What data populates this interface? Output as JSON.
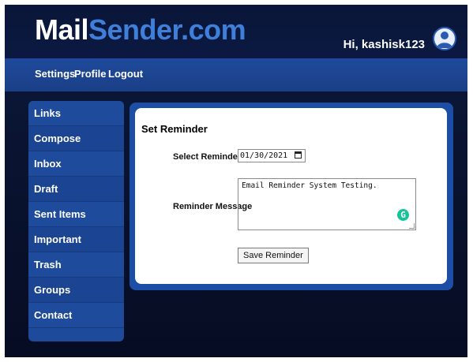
{
  "header": {
    "logo_part1": "Mail",
    "logo_part2": "Sender.com",
    "greeting": "Hi, kashisk123"
  },
  "nav": {
    "items": [
      "Settings",
      "Profile",
      "Logout"
    ]
  },
  "sidebar": {
    "items": [
      "Links",
      "Compose",
      "Inbox",
      "Draft",
      "Sent Items",
      "Important",
      "Trash",
      "Groups",
      "Contact"
    ]
  },
  "form": {
    "title": "Set Reminder",
    "date_label": "Select Reminder Date",
    "date_value": "01/30/2021",
    "message_label": "Reminder Message",
    "message_value": "Email Reminder System Testing.",
    "save_label": "Save Reminder"
  },
  "colors": {
    "brand_white": "#ffffff",
    "brand_blue": "#3f7fd9",
    "navbar": "#1f4a9c",
    "background": "#0a1431",
    "grammarly": "#15c39a"
  },
  "icons": {
    "avatar": "user-avatar-icon",
    "calendar": "calendar-icon",
    "grammarly": "grammarly-icon"
  }
}
